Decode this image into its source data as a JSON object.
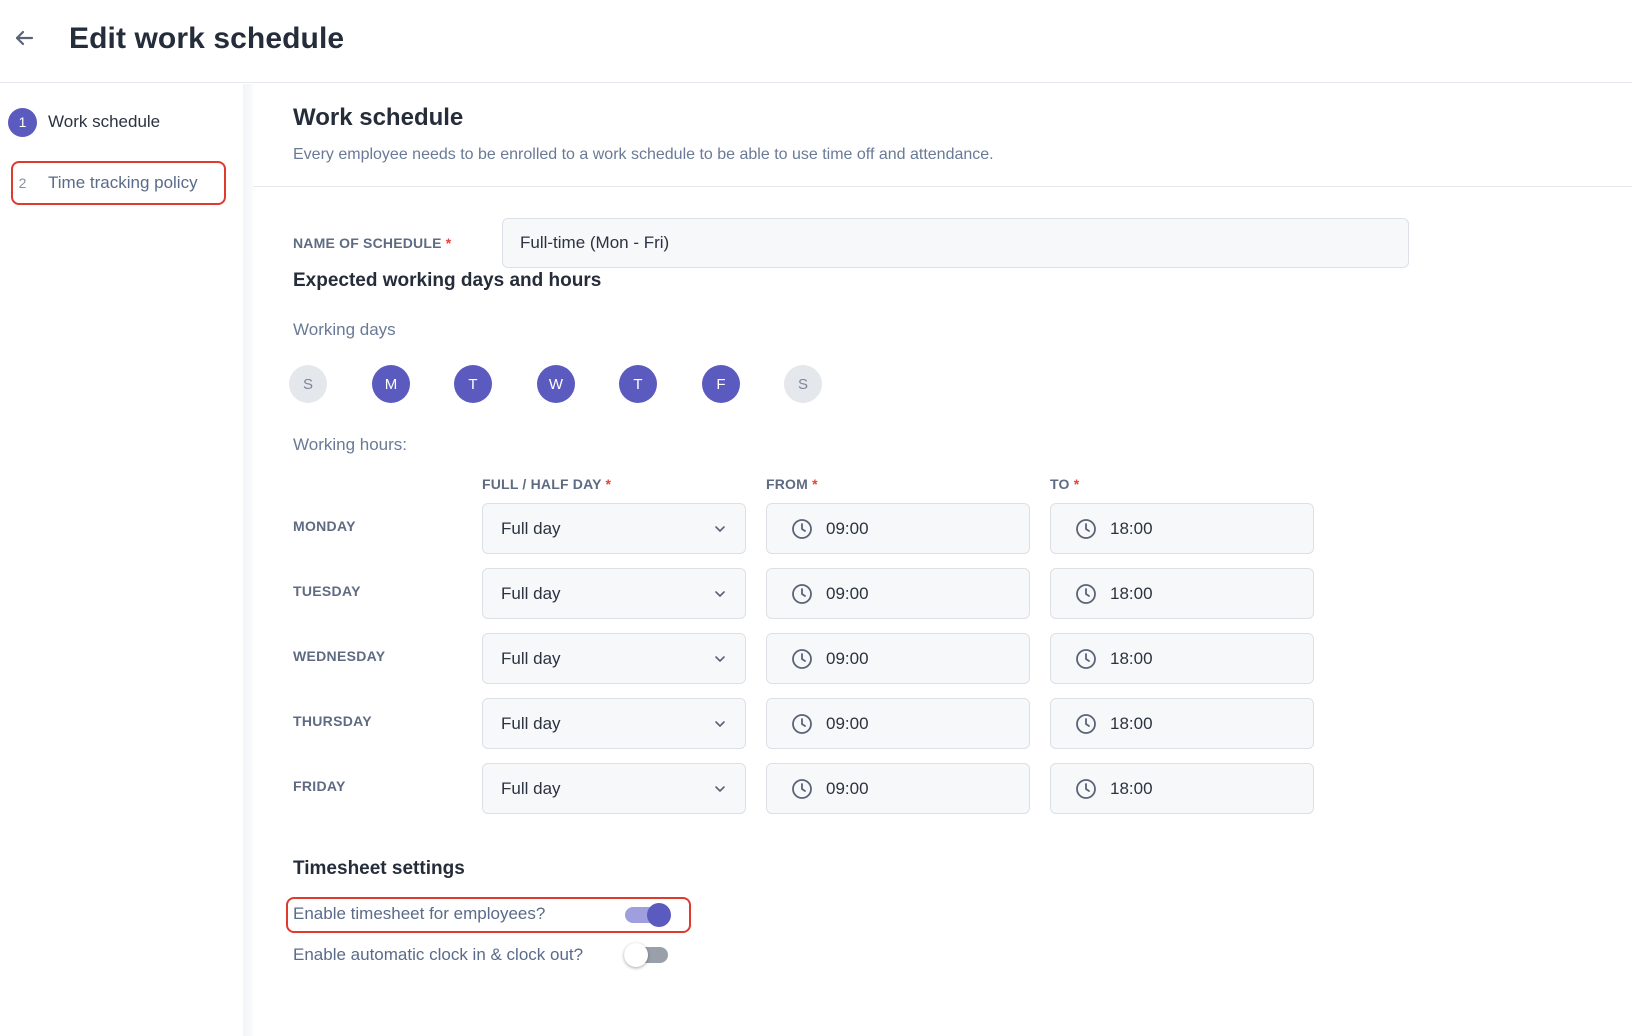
{
  "header": {
    "title": "Edit work schedule"
  },
  "sidebar": {
    "steps": [
      {
        "number": "1",
        "label": "Work schedule",
        "active": true
      },
      {
        "number": "2",
        "label": "Time tracking policy",
        "active": false
      }
    ]
  },
  "main": {
    "section_title": "Work schedule",
    "section_subtitle": "Every employee needs to be enrolled to a work schedule to be able to use time off and attendance.",
    "name_field": {
      "label": "NAME OF SCHEDULE",
      "required_mark": "*",
      "value": "Full-time (Mon - Fri)"
    },
    "expected_heading": "Expected working days and hours",
    "working_days_label": "Working days",
    "working_days": [
      {
        "letter": "S",
        "selected": false
      },
      {
        "letter": "M",
        "selected": true
      },
      {
        "letter": "T",
        "selected": true
      },
      {
        "letter": "W",
        "selected": true
      },
      {
        "letter": "T",
        "selected": true
      },
      {
        "letter": "F",
        "selected": true
      },
      {
        "letter": "S",
        "selected": false
      }
    ],
    "working_hours_label": "Working hours:",
    "columns": {
      "day_type": "FULL / HALF DAY",
      "from": "FROM",
      "to": "TO",
      "required_mark": "*"
    },
    "rows": [
      {
        "day": "MONDAY",
        "type": "Full day",
        "from": "09:00",
        "to": "18:00"
      },
      {
        "day": "TUESDAY",
        "type": "Full day",
        "from": "09:00",
        "to": "18:00"
      },
      {
        "day": "WEDNESDAY",
        "type": "Full day",
        "from": "09:00",
        "to": "18:00"
      },
      {
        "day": "THURSDAY",
        "type": "Full day",
        "from": "09:00",
        "to": "18:00"
      },
      {
        "day": "FRIDAY",
        "type": "Full day",
        "from": "09:00",
        "to": "18:00"
      }
    ],
    "timesheet": {
      "heading": "Timesheet settings",
      "enable_timesheet": {
        "label": "Enable timesheet for employees?",
        "on": true
      },
      "auto_clock": {
        "label": "Enable automatic clock in & clock out?",
        "on": false
      }
    }
  },
  "colors": {
    "accent": "#5b5bbf",
    "highlight": "#e03a2f",
    "required": "#e0453a"
  },
  "icons": {
    "back": "arrow-left-icon",
    "chevron": "chevron-down-icon",
    "clock": "clock-icon"
  }
}
